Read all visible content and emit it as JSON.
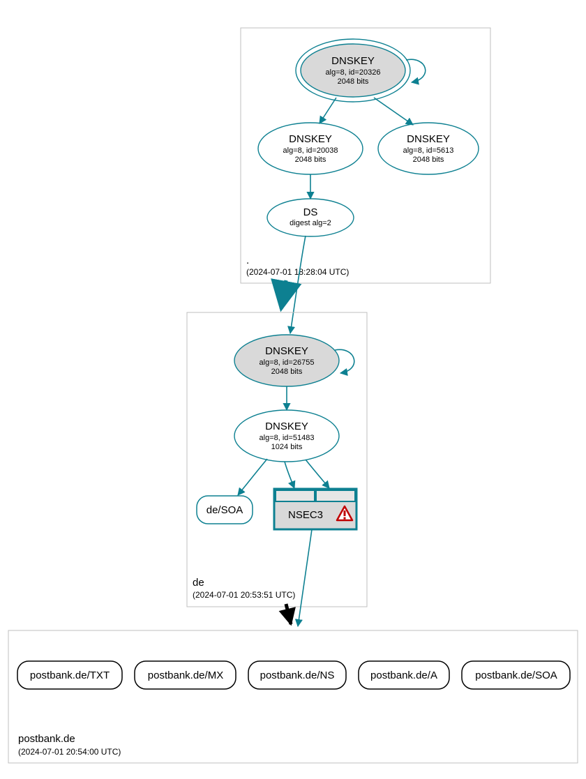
{
  "colors": {
    "teal": "#0d8091",
    "grey_fill": "#d9d9d9",
    "warn": "#c00000"
  },
  "zone_root": {
    "name": ".",
    "timestamp": "(2024-07-01 18:28:04 UTC)",
    "dnskey_ksk": {
      "title": "DNSKEY",
      "line1": "alg=8, id=20326",
      "line2": "2048 bits"
    },
    "dnskey_zsk": {
      "title": "DNSKEY",
      "line1": "alg=8, id=20038",
      "line2": "2048 bits"
    },
    "dnskey_other": {
      "title": "DNSKEY",
      "line1": "alg=8, id=5613",
      "line2": "2048 bits"
    },
    "ds": {
      "title": "DS",
      "line1": "digest alg=2"
    }
  },
  "zone_de": {
    "name": "de",
    "timestamp": "(2024-07-01 20:53:51 UTC)",
    "dnskey_ksk": {
      "title": "DNSKEY",
      "line1": "alg=8, id=26755",
      "line2": "2048 bits"
    },
    "dnskey_zsk": {
      "title": "DNSKEY",
      "line1": "alg=8, id=51483",
      "line2": "1024 bits"
    },
    "soa_label": "de/SOA",
    "nsec3_label": "NSEC3"
  },
  "zone_domain": {
    "name": "postbank.de",
    "timestamp": "(2024-07-01 20:54:00 UTC)",
    "records": {
      "txt": "postbank.de/TXT",
      "mx": "postbank.de/MX",
      "ns": "postbank.de/NS",
      "a": "postbank.de/A",
      "soa": "postbank.de/SOA"
    }
  }
}
